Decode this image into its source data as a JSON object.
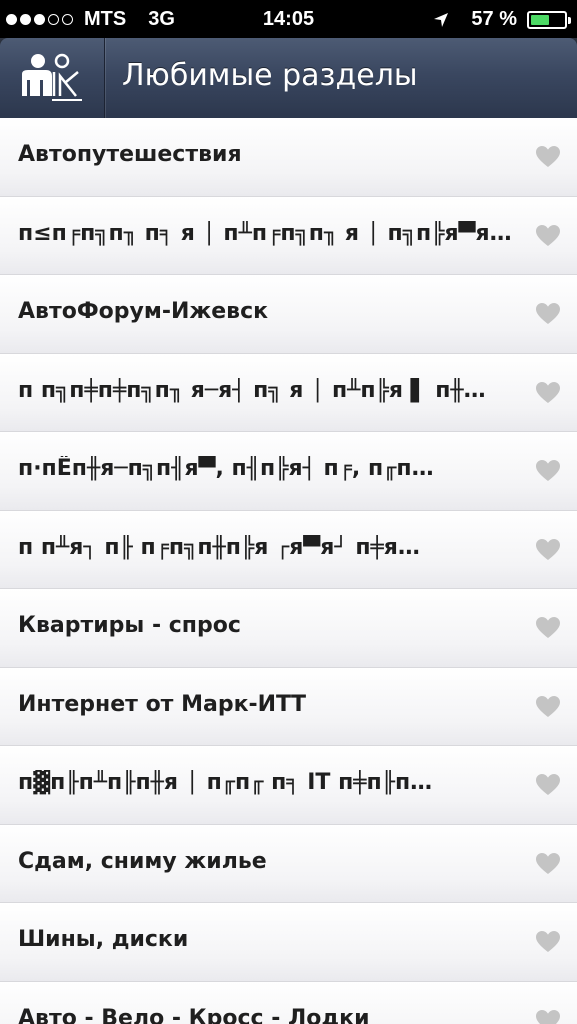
{
  "status_bar": {
    "signal_dots_filled": 3,
    "signal_dots_total": 5,
    "carrier": "MTS",
    "network": "3G",
    "time": "14:05",
    "battery_percent_text": "57 %",
    "battery_level": 0.57,
    "battery_color": "#4cd964"
  },
  "nav": {
    "title": "Любимые разделы",
    "logo_icon": "people-logo-icon"
  },
  "favorites": [
    {
      "label": "Автопутешествия"
    },
    {
      "label": "п≤п╒п╗п╖ п╕ я │ п╨п╒п╗п╖ я │ п╗п╠я▀я…"
    },
    {
      "label": "АвтоФорум-Ижевск"
    },
    {
      "label": "п п╗п╪п╪п╗п╖ я─я┤ п╗ я │ п╨п╠я ▌ п╫…"
    },
    {
      "label": "п·пЁп╫я─п╗п╢я▀, п╢п╠я┤ п╒, п╓п…"
    },
    {
      "label": "п п╨я┐ п╟ п╒п╗п╫п╠я ┌я▀я┘ п╪я…"
    },
    {
      "label": "Квартиры - спрос"
    },
    {
      "label": "Интернет от Марк-ИТТ"
    },
    {
      "label": "п▓п╟п╨п╟п╫я │ п╓п╓ п╕ IT п╪п╟п…"
    },
    {
      "label": "Сдам, сниму жилье"
    },
    {
      "label": "Шины, диски"
    },
    {
      "label": "Авто - Вело - Кросс - Лодки"
    }
  ],
  "colors": {
    "heart": "#c4c4c4",
    "nav_bar": "#3a4760"
  }
}
